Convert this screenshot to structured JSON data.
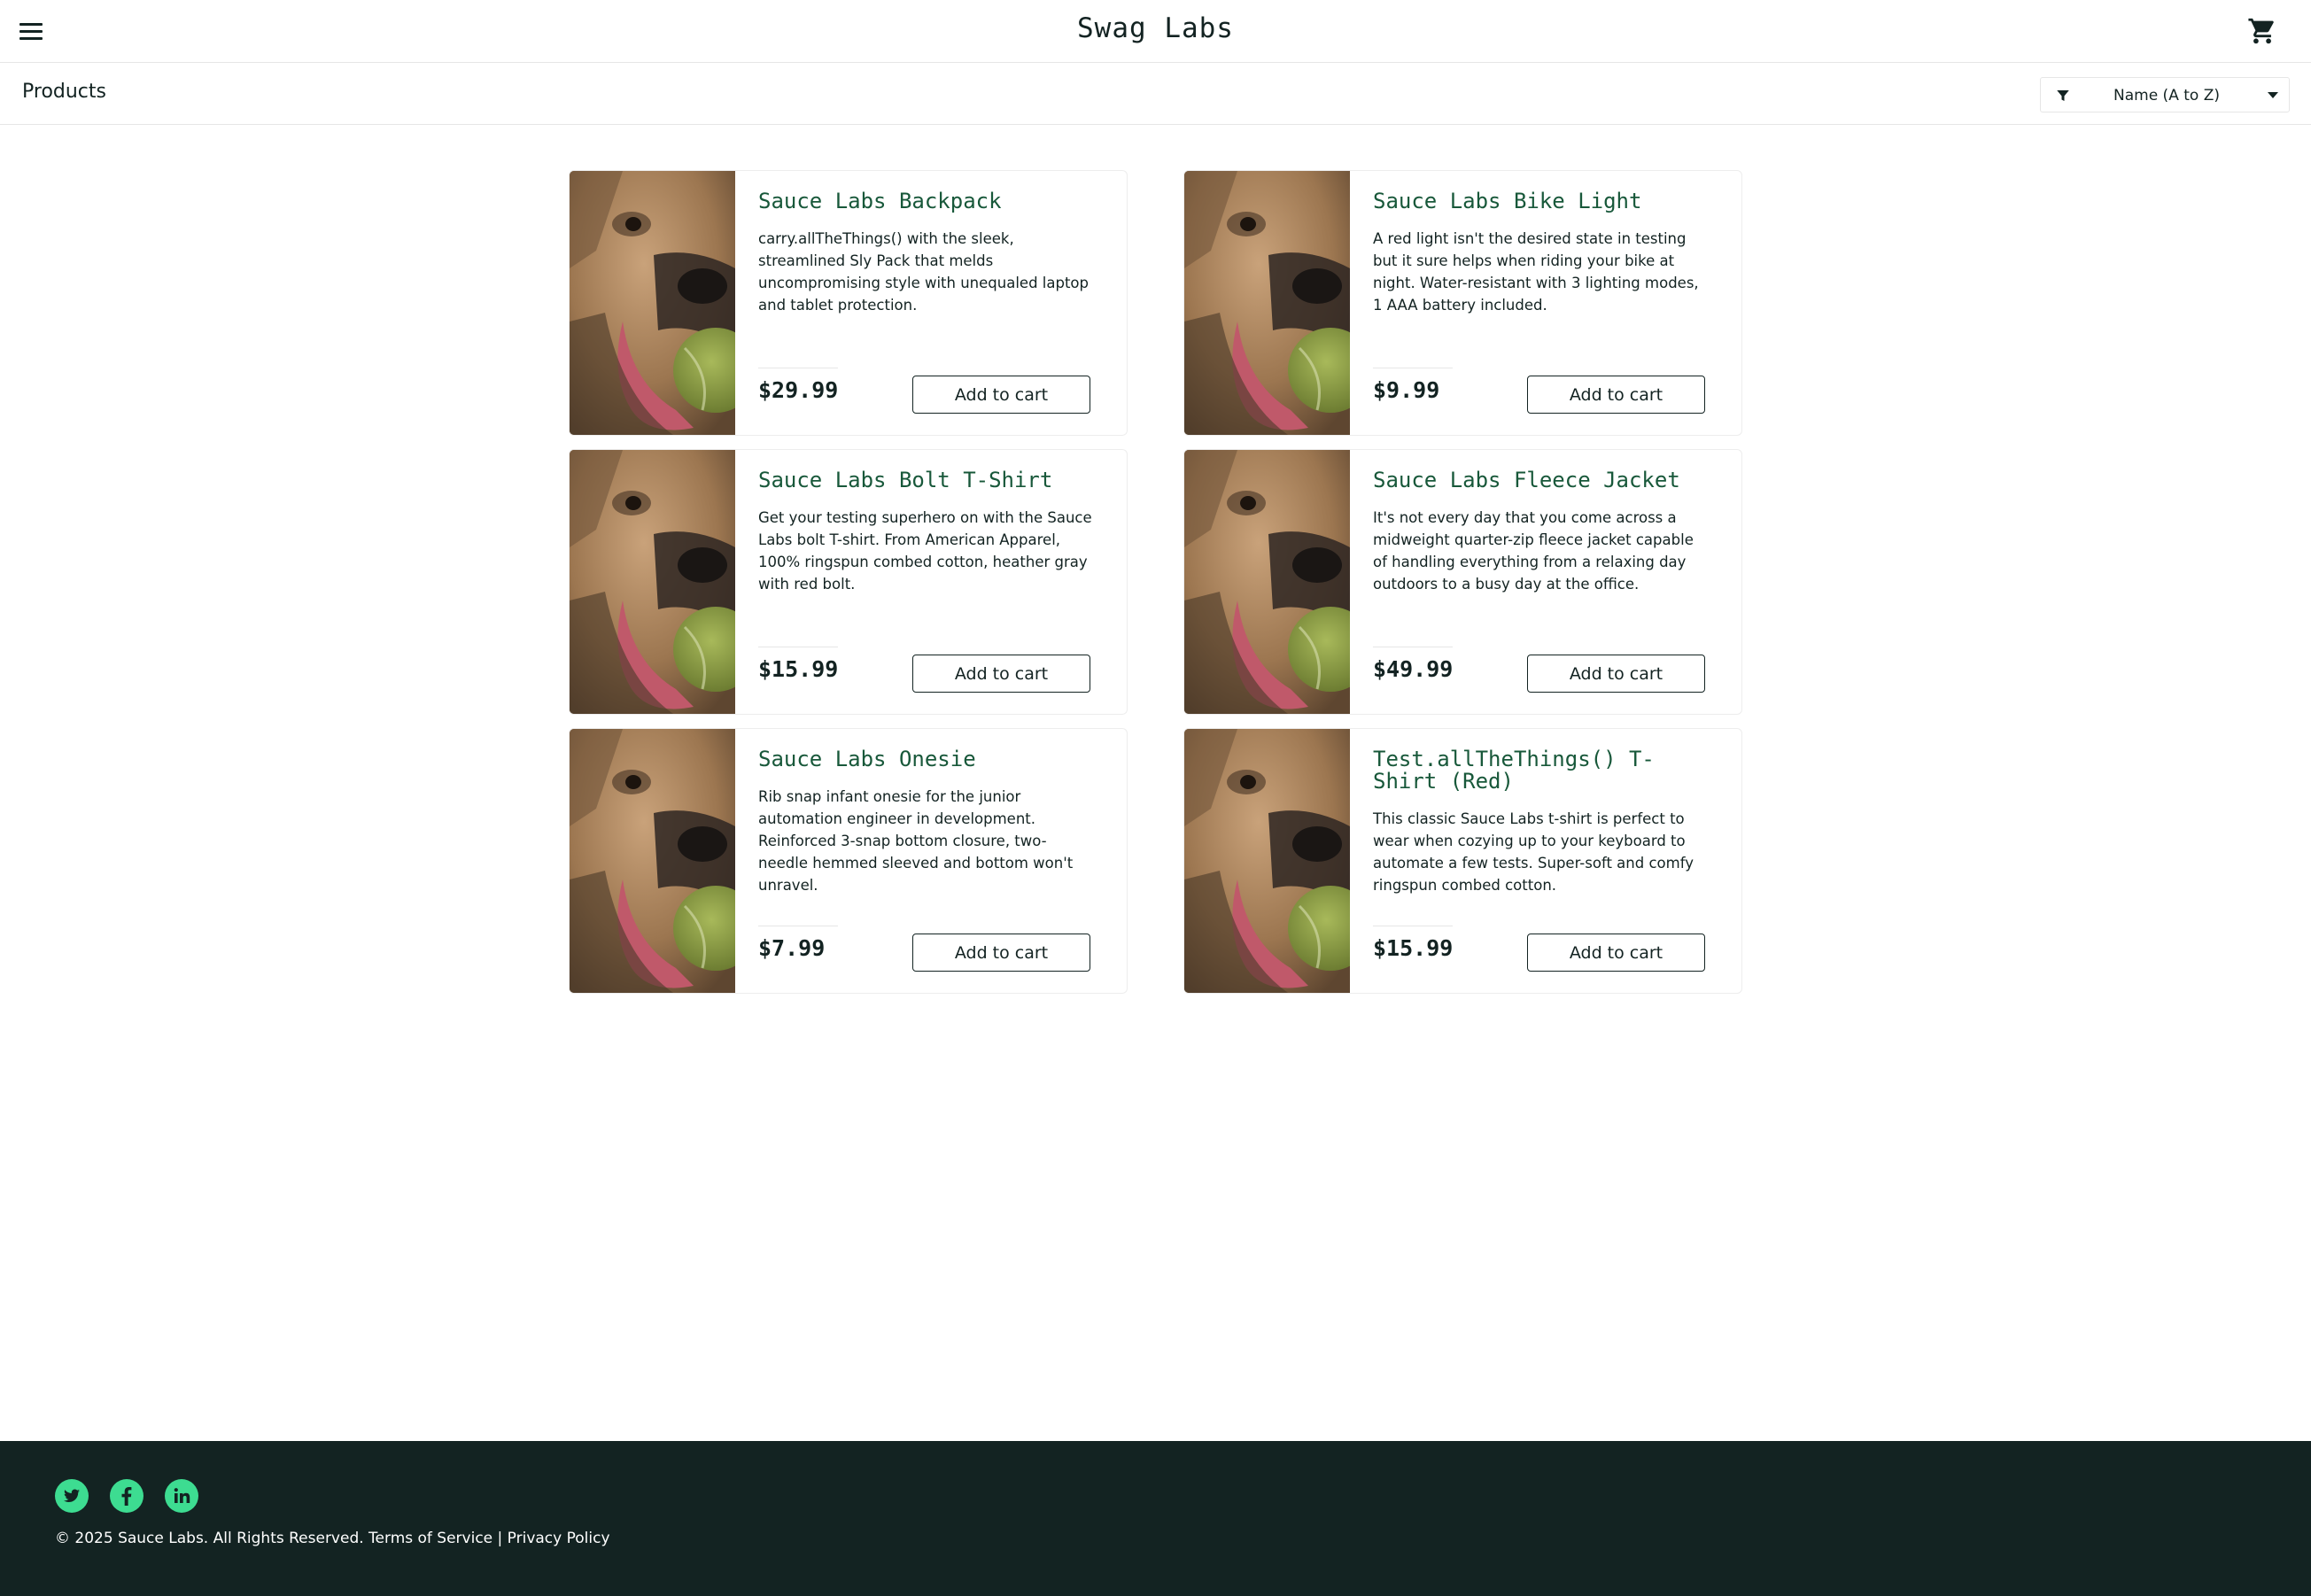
{
  "header": {
    "app_title": "Swag Labs",
    "menu_icon": "hamburger-menu-icon",
    "cart_icon": "shopping-cart-icon"
  },
  "subheader": {
    "title": "Products",
    "sort": {
      "selected": "Name (A to Z)",
      "filter_icon": "filter-icon",
      "caret_icon": "caret-down-icon"
    }
  },
  "products": [
    {
      "name": "Sauce Labs Backpack",
      "description": "carry.allTheThings() with the sleek, streamlined Sly Pack that melds uncompromising style with unequaled laptop and tablet protection.",
      "price": "$29.99",
      "button": "Add to cart"
    },
    {
      "name": "Sauce Labs Bike Light",
      "description": "A red light isn't the desired state in testing but it sure helps when riding your bike at night. Water-resistant with 3 lighting modes, 1 AAA battery included.",
      "price": "$9.99",
      "button": "Add to cart"
    },
    {
      "name": "Sauce Labs Bolt T-Shirt",
      "description": "Get your testing superhero on with the Sauce Labs bolt T-shirt. From American Apparel, 100% ringspun combed cotton, heather gray with red bolt.",
      "price": "$15.99",
      "button": "Add to cart"
    },
    {
      "name": "Sauce Labs Fleece Jacket",
      "description": "It's not every day that you come across a midweight quarter-zip fleece jacket capable of handling everything from a relaxing day outdoors to a busy day at the office.",
      "price": "$49.99",
      "button": "Add to cart"
    },
    {
      "name": "Sauce Labs Onesie",
      "description": "Rib snap infant onesie for the junior automation engineer in development. Reinforced 3-snap bottom closure, two-needle hemmed sleeved and bottom won't unravel.",
      "price": "$7.99",
      "button": "Add to cart"
    },
    {
      "name": "Test.allTheThings() T-Shirt (Red)",
      "description": "This classic Sauce Labs t-shirt is perfect to wear when cozying up to your keyboard to automate a few tests. Super-soft and comfy ringspun combed cotton.",
      "price": "$15.99",
      "button": "Add to cart"
    }
  ],
  "footer": {
    "social": [
      "twitter-icon",
      "facebook-icon",
      "linkedin-icon"
    ],
    "copyright": "© 2025 Sauce Labs. All Rights Reserved. Terms of Service | Privacy Policy",
    "background_color": "#132322",
    "accent_color": "#3ddc91"
  },
  "colors": {
    "product_name": "#18583a",
    "text": "#132322"
  }
}
